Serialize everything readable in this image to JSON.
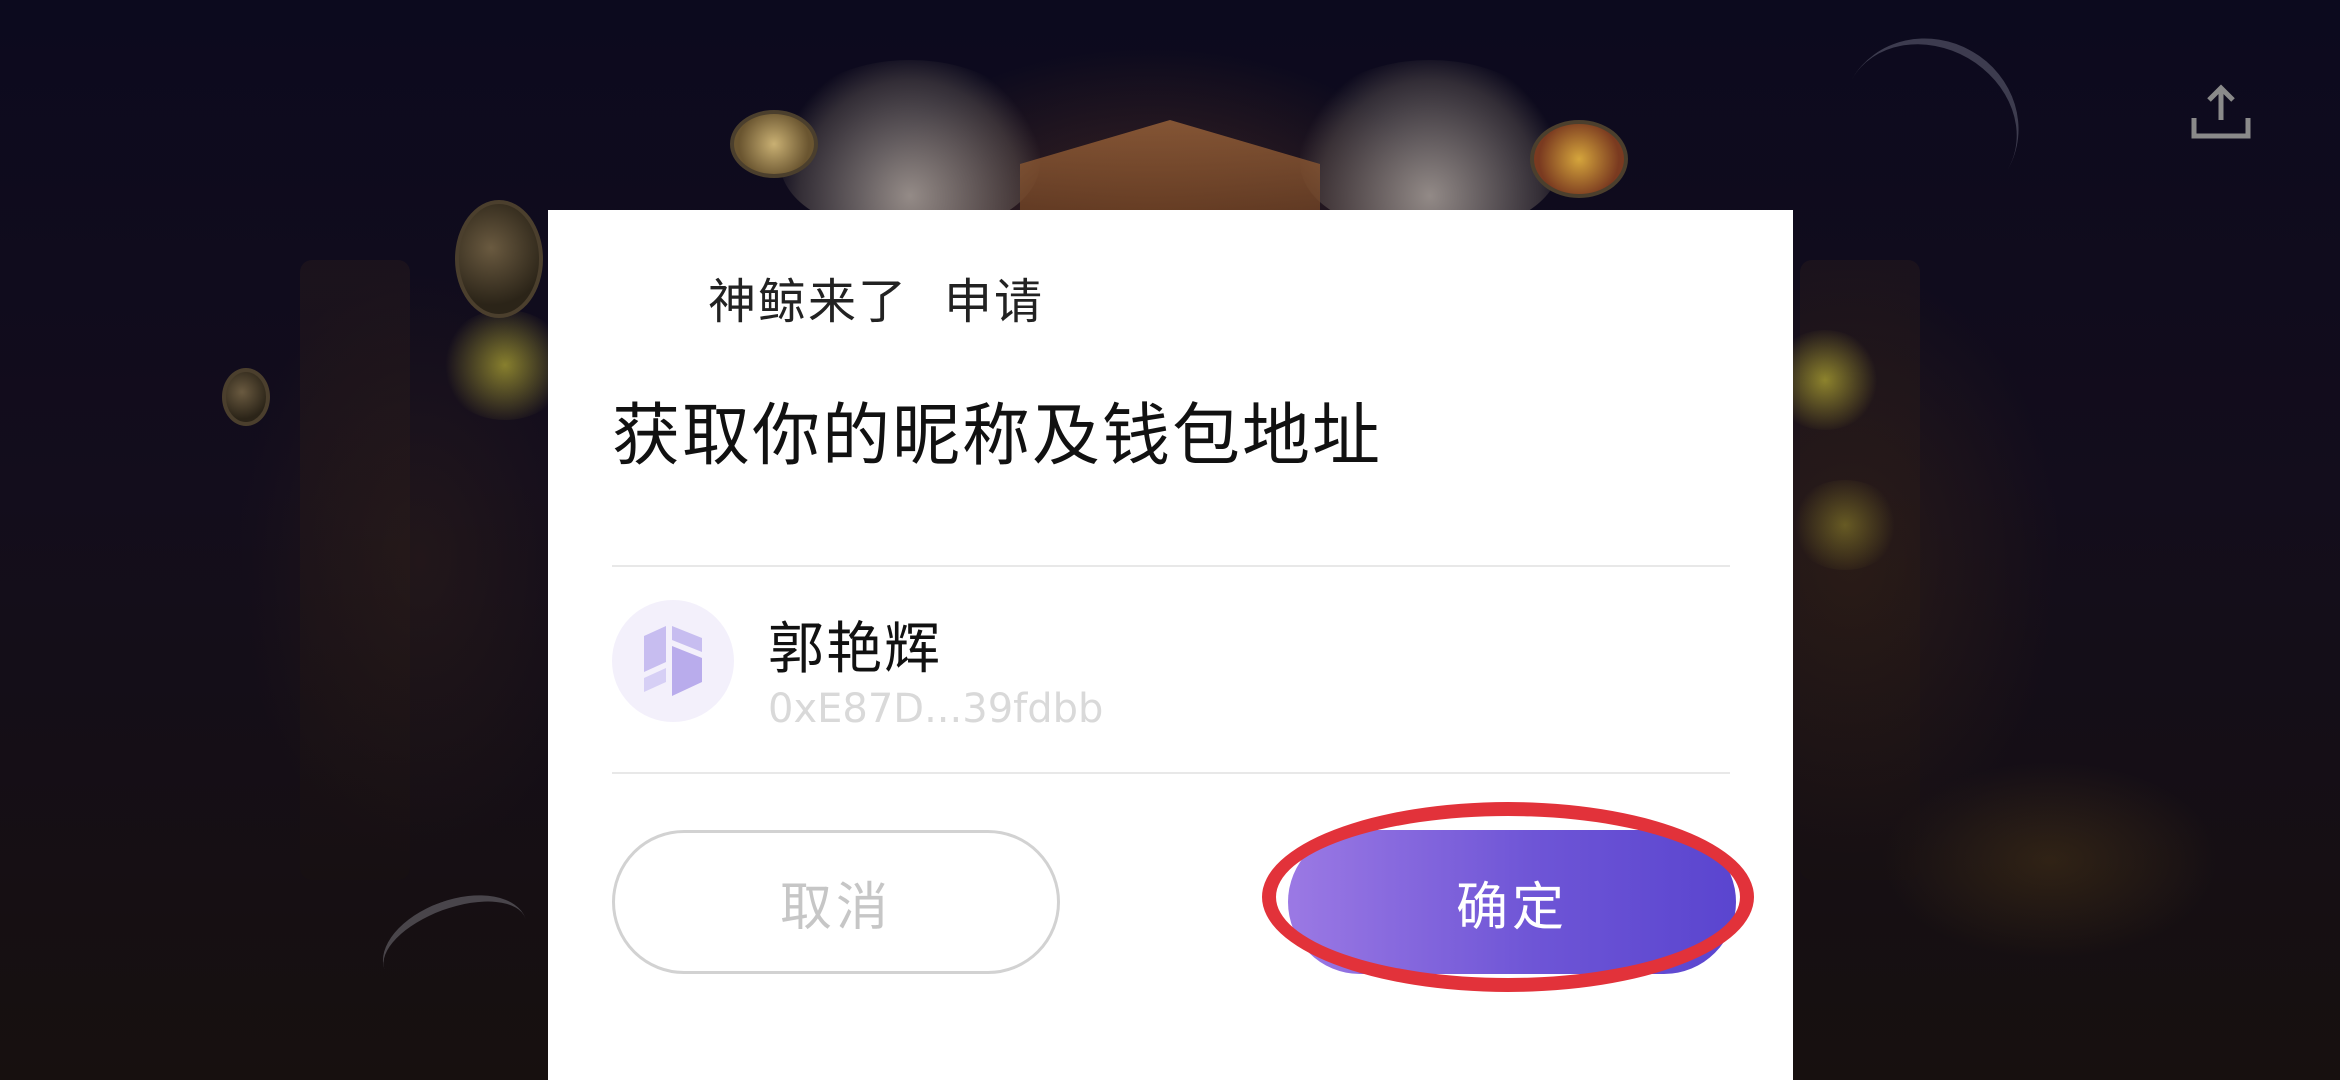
{
  "dialog": {
    "app_name": "神鲸来了",
    "request_label": "申请",
    "title": "获取你的昵称及钱包地址",
    "account": {
      "nickname": "郭艳辉",
      "wallet_address": "0xE87D...39fdbb",
      "avatar_icon": "wallet-logo-icon"
    },
    "cancel_label": "取消",
    "confirm_label": "确定"
  },
  "toolbar": {
    "share_icon": "share-upload-icon"
  },
  "annotation": {
    "highlight_color": "#e2323a",
    "highlighted": "confirm-button"
  },
  "colors": {
    "confirm_start": "#9b79e4",
    "confirm_end": "#5a45cf"
  }
}
